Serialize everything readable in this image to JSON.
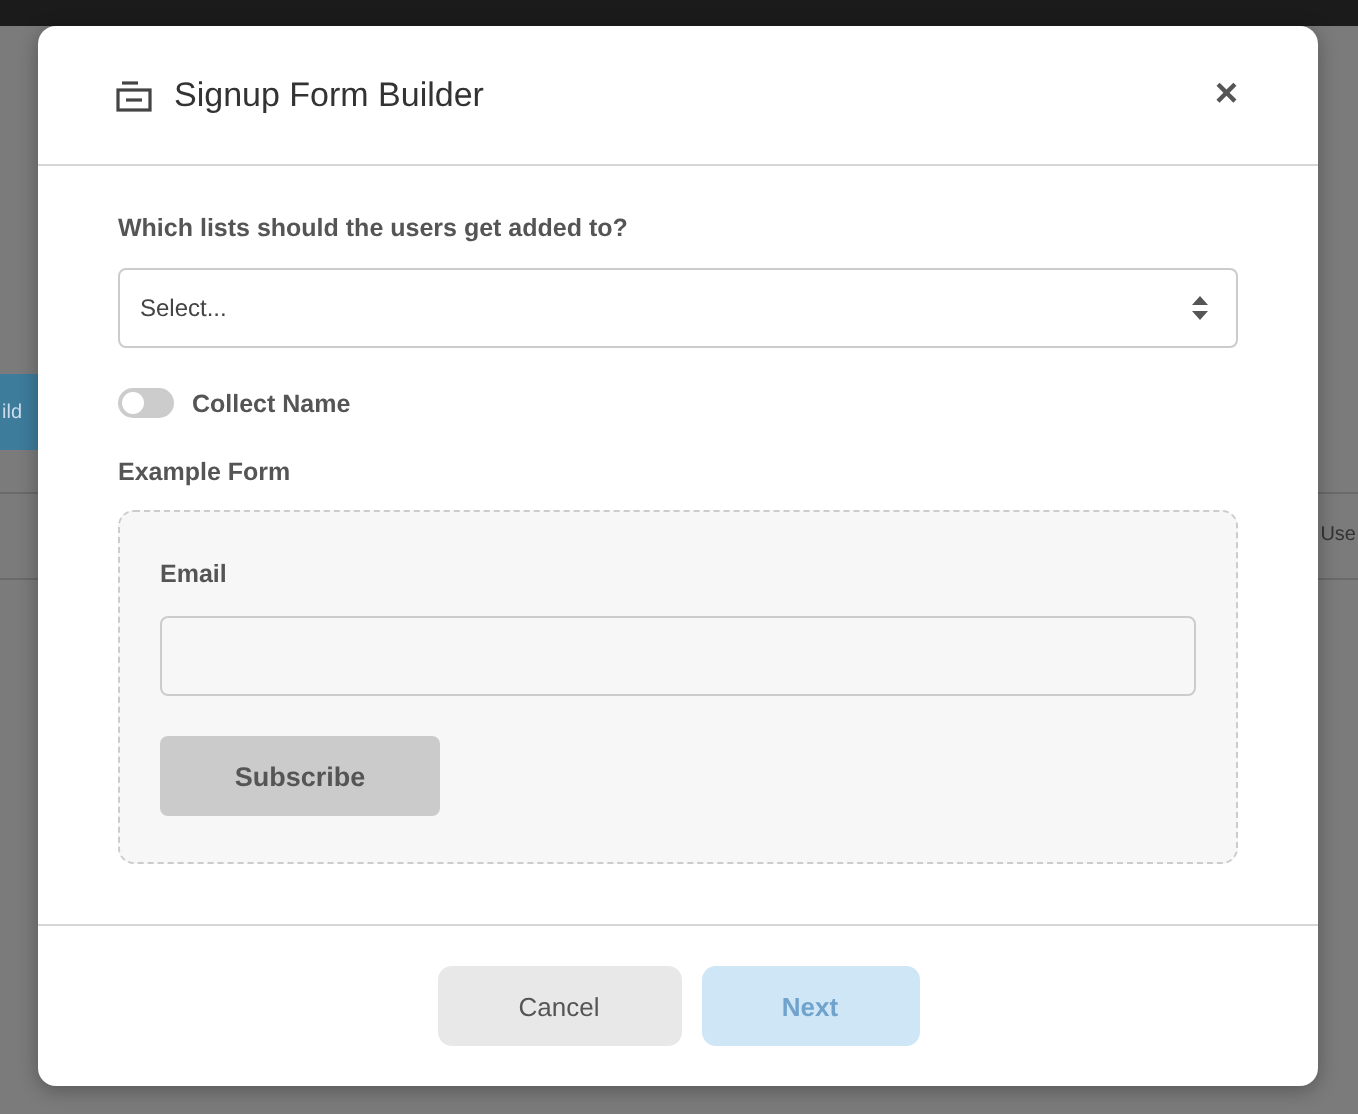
{
  "background": {
    "button_label": "ild",
    "column_label": "Use"
  },
  "dialog": {
    "title": "Signup Form Builder",
    "close": "×"
  },
  "lists": {
    "label": "Which lists should the users get added to?",
    "placeholder": "Select..."
  },
  "collect_name": {
    "label": "Collect Name",
    "on": false
  },
  "example": {
    "heading": "Example Form",
    "field_label": "Email",
    "button": "Subscribe"
  },
  "footer": {
    "buttons": [
      {
        "label": "Cancel",
        "kind": "secondary",
        "disabled": false
      },
      {
        "label": "Next",
        "kind": "primary",
        "disabled": true
      }
    ]
  }
}
